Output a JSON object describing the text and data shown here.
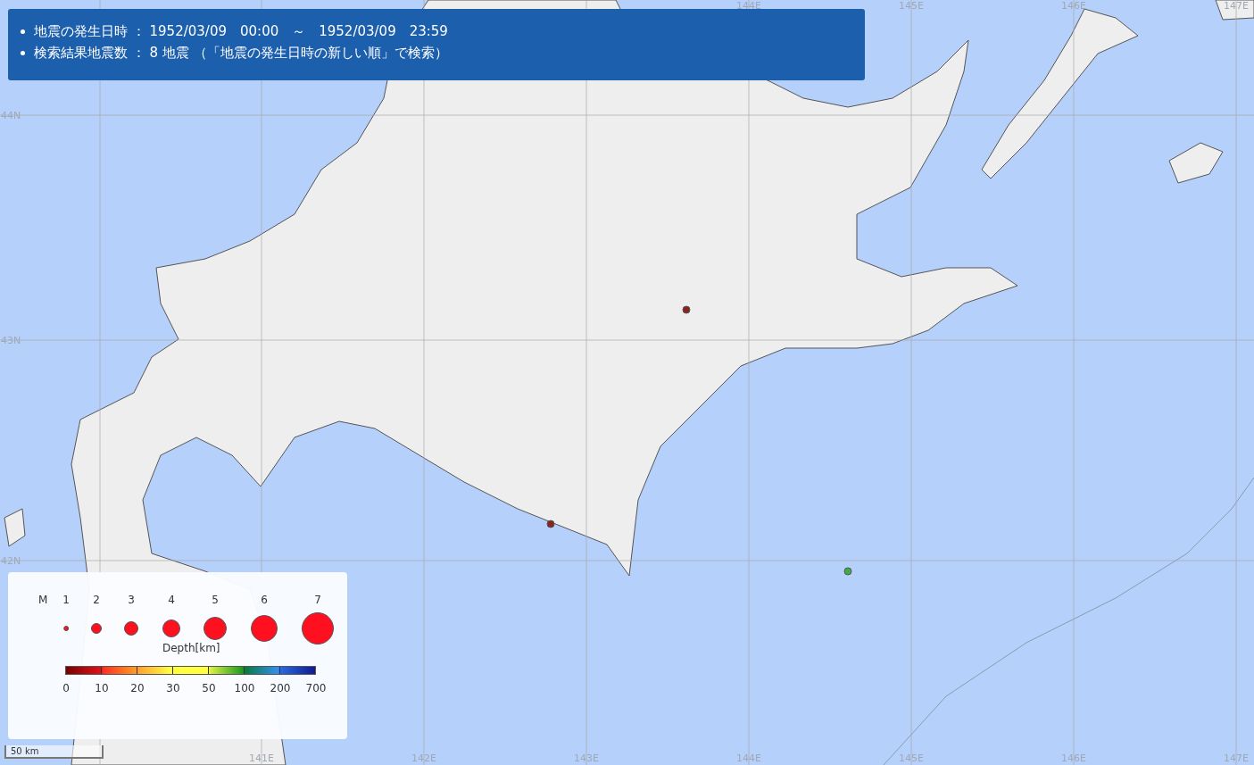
{
  "summary": {
    "lines": [
      "地震の発生日時 ： 1952/03/09　00:00　～　1952/03/09　23:59",
      "検索結果地震数 ： 8 地震 （「地震の発生日時の新しい順」で検索）"
    ]
  },
  "map": {
    "top_labels": [
      "144E",
      "145E",
      "146E",
      "147E"
    ],
    "bottom_labels": [
      "141E",
      "142E",
      "143E",
      "144E",
      "145E",
      "146E",
      "147E"
    ],
    "left_labels": [
      "44N",
      "43N",
      "42N"
    ],
    "quakes": [
      {
        "color": "#8b2323"
      },
      {
        "color": "#8b2323"
      },
      {
        "color": "#3cb043"
      }
    ],
    "scale": "50 km"
  },
  "legend": {
    "magnitude_label": "M",
    "magnitudes": [
      "1",
      "2",
      "3",
      "4",
      "5",
      "6",
      "7"
    ],
    "depth_title": "Depth[km]",
    "depth_ticks": [
      "0",
      "10",
      "20",
      "30",
      "50",
      "100",
      "200",
      "700"
    ]
  }
}
